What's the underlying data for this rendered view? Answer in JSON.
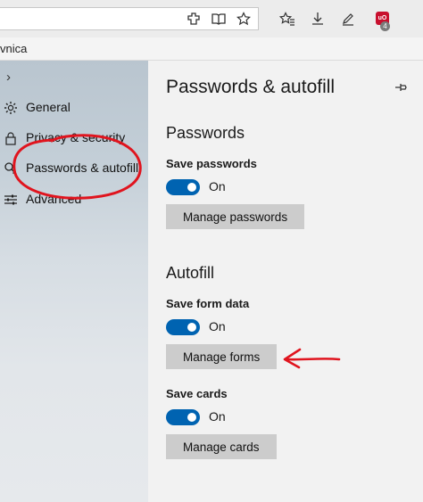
{
  "toolbar": {
    "icons": [
      "screenshot-icon",
      "reading-view-icon",
      "favorite-star-icon",
      "favorites-hub-icon",
      "downloads-icon",
      "pen-icon",
      "extension-icon"
    ],
    "extension_badge": "uO",
    "extension_count": "4"
  },
  "favorites_bar": {
    "text": "vnica"
  },
  "hub": {
    "items": [
      {
        "label": "General",
        "icon": "gear-icon"
      },
      {
        "label": "Privacy & security",
        "icon": "lock-icon"
      },
      {
        "label": "Passwords & autofill",
        "icon": "key-icon"
      },
      {
        "label": "Advanced",
        "icon": "sliders-icon"
      }
    ]
  },
  "settings": {
    "title": "Passwords & autofill",
    "passwords": {
      "heading": "Passwords",
      "save_label": "Save passwords",
      "save_state": "On",
      "manage_button": "Manage passwords"
    },
    "autofill": {
      "heading": "Autofill",
      "form_label": "Save form data",
      "form_state": "On",
      "forms_button": "Manage forms",
      "cards_label": "Save cards",
      "cards_state": "On",
      "cards_button": "Manage cards"
    }
  },
  "colors": {
    "accent": "#0063b1",
    "annotation": "#e0141e"
  }
}
